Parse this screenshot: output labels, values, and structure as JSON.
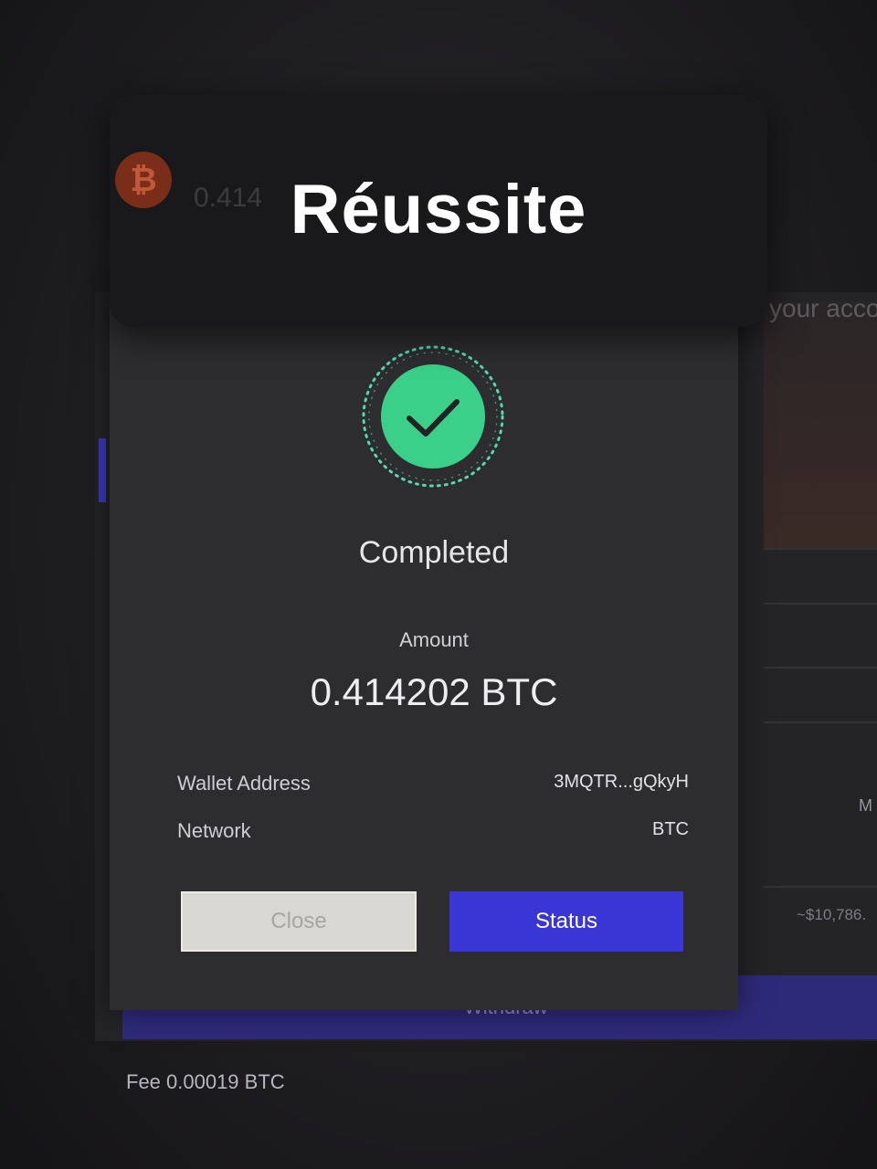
{
  "overlay": {
    "title": "Réussite"
  },
  "notification": {
    "coin_icon": "bitcoin-icon",
    "amount_partial": "0.414"
  },
  "background": {
    "right_text": "your acco",
    "right_col_label": "M",
    "right_value": "~$10,786.",
    "withdraw_label": "Withdraw",
    "fee": "Fee 0.00019 BTC"
  },
  "modal": {
    "status_icon": "check-circle-icon",
    "status_title": "Completed",
    "amount_label": "Amount",
    "amount_value": "0.414202 BTC",
    "details": [
      {
        "label": "Wallet Address",
        "value": "3MQTR...gQkyH"
      },
      {
        "label": "Network",
        "value": "BTC"
      }
    ],
    "close_label": "Close",
    "status_label": "Status"
  },
  "colors": {
    "success": "#3bd08a",
    "primary_button": "#3a36d6",
    "modal_bg": "#2d2d2f"
  }
}
